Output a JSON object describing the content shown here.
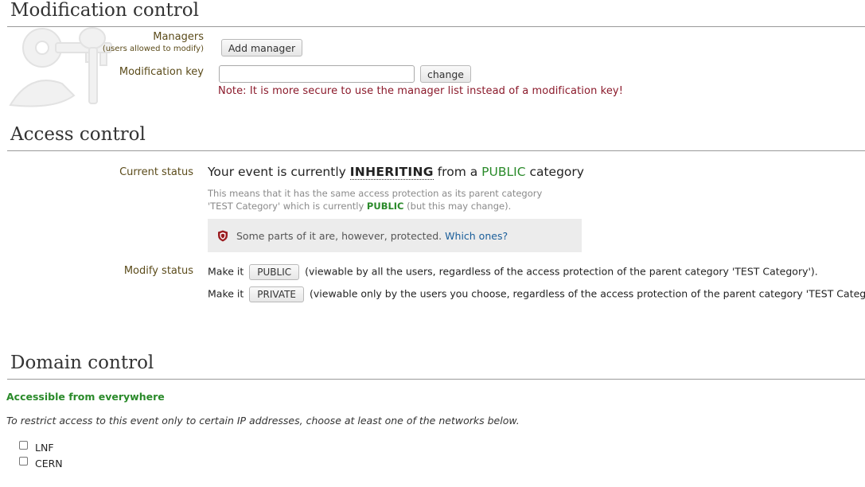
{
  "modification": {
    "title": "Modification control",
    "managers_label": "Managers",
    "managers_sub": "(users allowed to modify)",
    "add_manager_label": "Add manager",
    "key_label": "Modification key",
    "key_value": "",
    "change_label": "change",
    "note": "Note: It is more secure to use the manager list instead of a modification key!"
  },
  "access": {
    "title": "Access control",
    "current_status_label": "Current status",
    "status_prefix": "Your event is currently",
    "status_word": "INHERITING",
    "status_mid": "from a",
    "status_public": "PUBLIC",
    "status_suffix": "category",
    "desc_line1": "This means that it has the same access protection as its parent category",
    "desc_line2_prefix": "'TEST Category' which is currently",
    "desc_public": "PUBLIC",
    "desc_line2_suffix": "(but this may change).",
    "protected_text": "Some parts of it are, however, protected.",
    "which_ones": "Which ones?",
    "modify_status_label": "Modify status",
    "make_it": "Make it",
    "public_button": "PUBLIC",
    "public_desc": "(viewable by all the users, regardless of the access protection of the parent category 'TEST Category').",
    "private_button": "PRIVATE",
    "private_desc": "(viewable only by the users you choose, regardless of the access protection of the parent category 'TEST Category')."
  },
  "domain": {
    "title": "Domain control",
    "status": "Accessible from everywhere",
    "instructions": "To restrict access to this event only to certain IP addresses, choose at least one of the networks below.",
    "networks": [
      {
        "label": "LNF",
        "checked": false
      },
      {
        "label": "CERN",
        "checked": false
      }
    ]
  },
  "colors": {
    "label_brown": "#5b4b1a",
    "note_red": "#8b1a2b",
    "public_green": "#2a8a2a",
    "link_blue": "#1a5e9a",
    "shield_red": "#9b1c20"
  },
  "icons": [
    "keys-watermark-icon",
    "shield-icon"
  ]
}
